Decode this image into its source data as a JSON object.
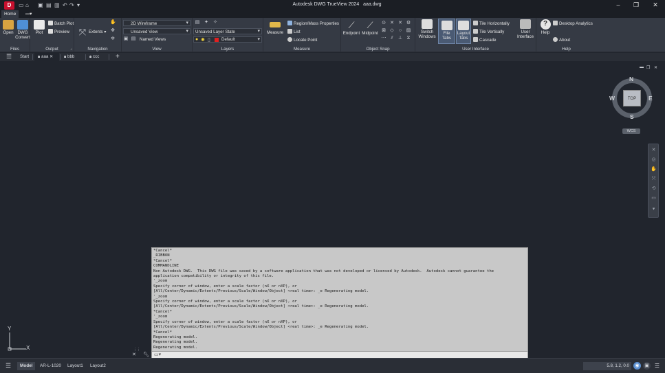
{
  "app": {
    "logo_letter": "D",
    "title": "Autodesk DWG TrueView 2024",
    "filename": "aaa.dwg"
  },
  "ribbon": {
    "tabs": [
      "Home",
      "▭▾"
    ],
    "panels": {
      "files": {
        "title": "Files",
        "open": "Open",
        "dwg_convert_1": "DWG",
        "dwg_convert_2": "Convert"
      },
      "output": {
        "title": "Output",
        "plot": "Plot",
        "batch_plot": "Batch Plot",
        "preview": "Preview"
      },
      "navigation": {
        "title": "Navigation",
        "extents": "Extents"
      },
      "view": {
        "title": "View",
        "visual_style": "2D Wireframe",
        "saved_view": "Unsaved View",
        "named_views": "Named Views"
      },
      "layers": {
        "title": "Layers",
        "layer_state": "Unsaved Layer State",
        "current_layer": "Default"
      },
      "measure": {
        "title": "Measure",
        "measure": "Measure",
        "region_props": "Region/Mass Properties",
        "list": "List",
        "locate_point": "Locate Point"
      },
      "object_snap": {
        "title": "Object Snap",
        "endpoint": "Endpoint",
        "midpoint": "Midpoint"
      },
      "user_interface": {
        "title": "User Interface",
        "switch_windows_1": "Switch",
        "switch_windows_2": "Windows",
        "file_tabs": "File Tabs",
        "layout_tabs_1": "Layout",
        "layout_tabs_2": "Tabs",
        "tile_h": "Tile Horizontally",
        "tile_v": "Tile Vertically",
        "cascade": "Cascade",
        "user_interface_1": "User",
        "user_interface_2": "Interface"
      },
      "help": {
        "title": "Help",
        "help": "Help",
        "desktop_analytics": "Desktop Analytics",
        "about": "About"
      }
    }
  },
  "file_tabs": [
    {
      "label": "Start"
    },
    {
      "label": "aaa",
      "locked": true,
      "active": true
    },
    {
      "label": "bbb",
      "locked": true
    },
    {
      "label": "ccc",
      "locked": true
    }
  ],
  "viewcube": {
    "face": "TOP",
    "north": "N",
    "south": "S",
    "east": "E",
    "west": "W",
    "wcs": "WCS"
  },
  "ucs": {
    "x": "X",
    "y": "Y"
  },
  "command_history": [
    "*Cancel*",
    "_RIBBON",
    "*Cancel*",
    "COMMANDLINE",
    "Non Autodesk DWG.  This DWG file was saved by a software application that was not developed or licensed by Autodesk.  Autodesk cannot guarantee the",
    "application compatibility or integrity of this file.",
    "'_zoom",
    "Specify corner of window, enter a scale factor (nX or nXP), or",
    "[All/Center/Dynamic/Extents/Previous/Scale/Window/Object] <real time>: _e Regenerating model.",
    "'_zoom",
    "Specify corner of window, enter a scale factor (nX or nXP), or",
    "[All/Center/Dynamic/Extents/Previous/Scale/Window/Object] <real time>: _e Regenerating model.",
    "*Cancel*",
    "'_zoom",
    "Specify corner of window, enter a scale factor (nX or nXP), or",
    "[All/Center/Dynamic/Extents/Previous/Scale/Window/Object] <real time>: _e Regenerating model.",
    "*Cancel*",
    "Regenerating model.",
    "Regenerating model.",
    "Regenerating model."
  ],
  "command_input": {
    "placeholder": ""
  },
  "status": {
    "layout_tabs": [
      "Model",
      "AR-L-1020",
      "Layout1",
      "Layout2"
    ],
    "coordinates": "5.8, 1.2, 0.0"
  },
  "colors": {
    "accent": "#c8102e",
    "ribbon_bg": "#353a44",
    "canvas_bg": "#21252d",
    "cmd_bg": "#c8c8c8"
  }
}
